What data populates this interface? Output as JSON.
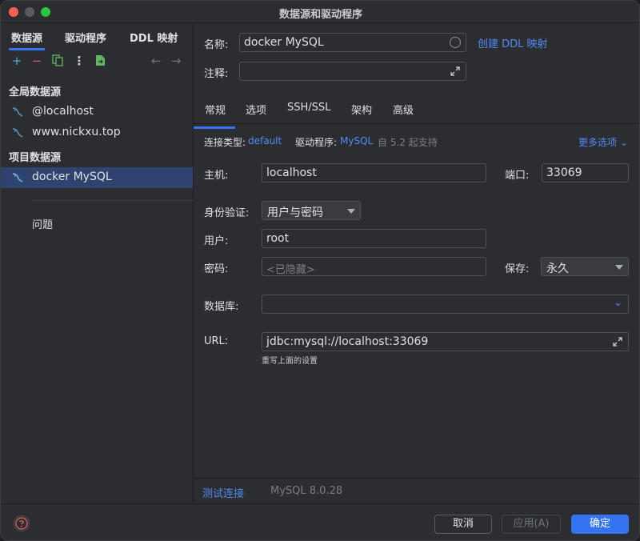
{
  "window": {
    "title": "数据源和驱动程序"
  },
  "left": {
    "tabs": [
      {
        "label": "数据源",
        "active": true
      },
      {
        "label": "驱动程序",
        "active": false
      },
      {
        "label": "DDL 映射",
        "active": false
      }
    ],
    "toolbar_icons": [
      "add-icon",
      "remove-icon",
      "duplicate-icon",
      "more-icon",
      "import-icon",
      "back-arrow-icon",
      "forward-arrow-icon"
    ],
    "sections": [
      {
        "title": "全局数据源",
        "items": [
          "@localhost",
          "www.nickxu.top"
        ]
      },
      {
        "title": "项目数据源",
        "items": [
          "docker MySQL"
        ]
      }
    ],
    "selected_item": "docker MySQL",
    "problems_label": "问题"
  },
  "form": {
    "name_label": "名称:",
    "name_value": "docker MySQL",
    "create_ddl_link": "创建 DDL 映射",
    "comment_label": "注释:",
    "comment_value": "",
    "tabs": [
      {
        "label": "常规",
        "active": true
      },
      {
        "label": "选项",
        "active": false
      },
      {
        "label": "SSH/SSL",
        "active": false
      },
      {
        "label": "架构",
        "active": false
      },
      {
        "label": "高级",
        "active": false
      }
    ],
    "conn_type_label": "连接类型:",
    "conn_type_value": "default",
    "driver_label": "驱动程序:",
    "driver_value": "MySQL",
    "driver_note": "自 5.2 起支持",
    "more_options": "更多选项",
    "host_label": "主机:",
    "host_value": "localhost",
    "port_label": "端口:",
    "port_value": "33069",
    "auth_label": "身份验证:",
    "auth_value": "用户与密码",
    "user_label": "用户:",
    "user_value": "root",
    "password_label": "密码:",
    "password_placeholder": "<已隐藏>",
    "save_label": "保存:",
    "save_value": "永久",
    "database_label": "数据库:",
    "database_value": "",
    "url_label": "URL:",
    "url_value": "jdbc:mysql://localhost:33069",
    "url_hint": "重写上面的设置",
    "test_connection": "测试连接",
    "server_version": "MySQL 8.0.28"
  },
  "footer": {
    "cancel": "取消",
    "apply": "应用(A)",
    "ok": "确定"
  },
  "colors": {
    "accent": "#3574f0",
    "link": "#548af7",
    "selection": "#2e436e",
    "background": "#2b2d30"
  }
}
